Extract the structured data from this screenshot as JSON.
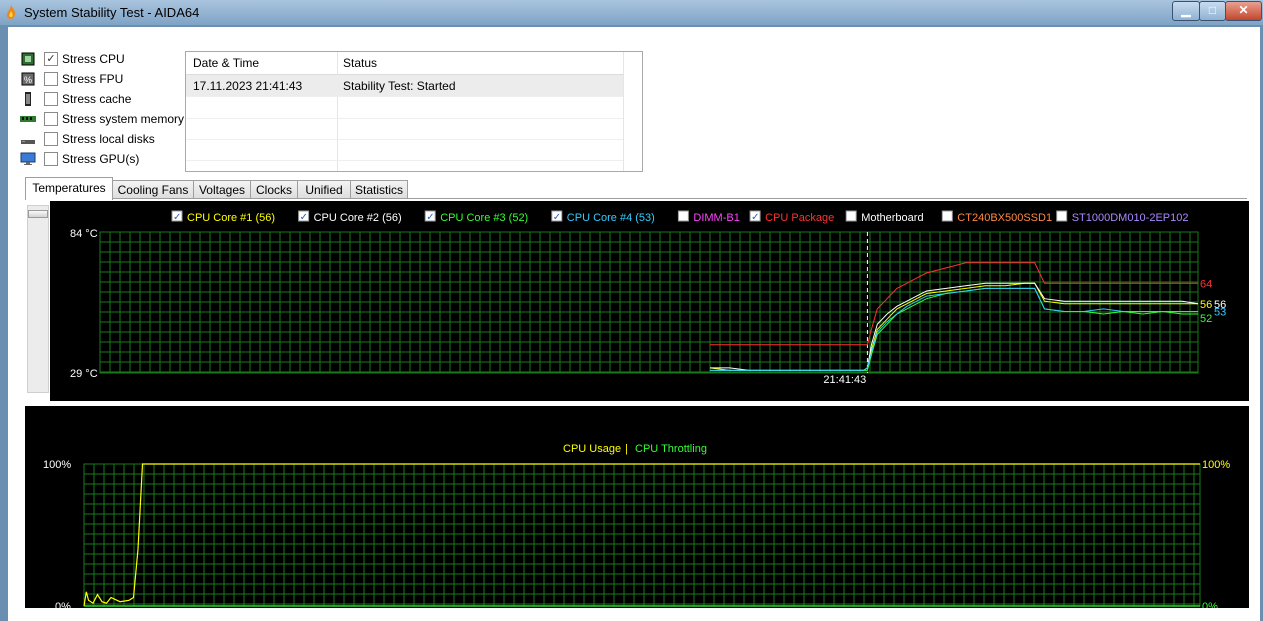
{
  "window": {
    "title": "System Stability Test - AIDA64",
    "min_label": "▁",
    "max_label": "□",
    "close_label": "✕"
  },
  "stress": [
    {
      "label": "Stress CPU",
      "checked": true,
      "icon": "cpu-icon"
    },
    {
      "label": "Stress FPU",
      "checked": false,
      "icon": "fpu-icon"
    },
    {
      "label": "Stress cache",
      "checked": false,
      "icon": "cache-icon"
    },
    {
      "label": "Stress system memory",
      "checked": false,
      "icon": "memory-icon"
    },
    {
      "label": "Stress local disks",
      "checked": false,
      "icon": "disk-icon"
    },
    {
      "label": "Stress GPU(s)",
      "checked": false,
      "icon": "gpu-icon"
    }
  ],
  "log": {
    "headers": [
      "Date & Time",
      "Status"
    ],
    "rows": [
      {
        "time": "17.11.2023 21:41:43",
        "status": "Stability Test: Started"
      }
    ]
  },
  "tabs": [
    "Temperatures",
    "Cooling Fans",
    "Voltages",
    "Clocks",
    "Unified",
    "Statistics"
  ],
  "chart_data": [
    {
      "type": "line",
      "ylim": [
        29,
        84
      ],
      "y_top_label": "84 °C",
      "y_bottom_label": "29 °C",
      "marker_time": "21:41:43",
      "legend": [
        {
          "label": "CPU Core #1 (56)",
          "checked": true,
          "color": "#ffff00"
        },
        {
          "label": "CPU Core #2 (56)",
          "checked": true,
          "color": "#ffffff"
        },
        {
          "label": "CPU Core #3 (52)",
          "checked": true,
          "color": "#33ff33"
        },
        {
          "label": "CPU Core #4 (53)",
          "checked": true,
          "color": "#33ccff"
        },
        {
          "label": "DIMM-B1",
          "checked": false,
          "color": "#ff44ff"
        },
        {
          "label": "CPU Package",
          "checked": true,
          "color": "#ff3333"
        },
        {
          "label": "Motherboard",
          "checked": false,
          "color": "#ffffff"
        },
        {
          "label": "CT240BX500SSD1",
          "checked": false,
          "color": "#ff8844"
        },
        {
          "label": "ST1000DM010-2EP102",
          "checked": false,
          "color": "#aa88ff"
        }
      ],
      "series": [
        {
          "name": "CPU Package",
          "color": "#ff3333",
          "end_label": "64",
          "x": [
            0,
            10,
            20,
            30,
            40,
            50,
            60,
            70,
            78,
            80,
            82,
            85,
            90,
            95,
            100,
            105,
            110,
            120,
            130,
            140,
            150,
            160,
            165,
            170,
            180,
            190,
            200,
            210,
            220,
            230,
            240,
            248
          ],
          "values": [
            40,
            40,
            40,
            40,
            40,
            40,
            40,
            40,
            40,
            40,
            46,
            54,
            58,
            62,
            64,
            66,
            68,
            70,
            72,
            72,
            72,
            72,
            72,
            64,
            64,
            64,
            64,
            64,
            64,
            64,
            64,
            64
          ]
        },
        {
          "name": "CPU Core #1",
          "color": "#ffff00",
          "end_label": "56",
          "x": [
            0,
            10,
            20,
            30,
            40,
            50,
            60,
            70,
            78,
            80,
            82,
            85,
            90,
            95,
            100,
            105,
            110,
            120,
            130,
            140,
            150,
            160,
            165,
            170,
            180,
            190,
            200,
            210,
            220,
            230,
            240,
            248
          ],
          "values": [
            31,
            30,
            30,
            30,
            30,
            30,
            30,
            30,
            30,
            31,
            38,
            46,
            50,
            54,
            56,
            58,
            60,
            61,
            62,
            63,
            63,
            64,
            64,
            57,
            56,
            56,
            56,
            56,
            56,
            56,
            56,
            56
          ]
        },
        {
          "name": "CPU Core #2",
          "color": "#ffffff",
          "end_label": "56",
          "x": [
            0,
            10,
            20,
            30,
            40,
            50,
            60,
            70,
            78,
            80,
            82,
            85,
            90,
            95,
            100,
            105,
            110,
            120,
            130,
            140,
            150,
            160,
            165,
            170,
            180,
            190,
            200,
            210,
            220,
            230,
            240,
            248
          ],
          "values": [
            31,
            31,
            30,
            30,
            30,
            30,
            30,
            30,
            30,
            31,
            40,
            48,
            52,
            55,
            57,
            59,
            61,
            62,
            63,
            64,
            64,
            64,
            64,
            58,
            57,
            57,
            57,
            57,
            57,
            57,
            57,
            56
          ]
        },
        {
          "name": "CPU Core #3",
          "color": "#33ff33",
          "end_label": "52",
          "x": [
            0,
            10,
            20,
            30,
            40,
            50,
            60,
            70,
            78,
            80,
            82,
            85,
            90,
            95,
            100,
            105,
            110,
            120,
            130,
            140,
            150,
            160,
            165,
            170,
            180,
            190,
            200,
            210,
            220,
            230,
            240,
            248
          ],
          "values": [
            30,
            30,
            30,
            30,
            30,
            30,
            30,
            30,
            30,
            30,
            36,
            44,
            48,
            52,
            54,
            56,
            58,
            60,
            61,
            62,
            62,
            62,
            62,
            54,
            53,
            53,
            52,
            53,
            52,
            53,
            52,
            52
          ]
        },
        {
          "name": "CPU Core #4",
          "color": "#33ccff",
          "end_label": "53",
          "x": [
            0,
            10,
            20,
            30,
            40,
            50,
            60,
            70,
            78,
            80,
            82,
            85,
            90,
            95,
            100,
            105,
            110,
            120,
            130,
            140,
            150,
            160,
            165,
            170,
            180,
            190,
            200,
            210,
            220,
            230,
            240,
            248
          ],
          "values": [
            30,
            30,
            30,
            30,
            30,
            30,
            30,
            30,
            30,
            31,
            37,
            45,
            49,
            52,
            55,
            57,
            59,
            60,
            61,
            62,
            62,
            62,
            62,
            54,
            53,
            53,
            54,
            53,
            53,
            53,
            53,
            53
          ]
        }
      ]
    },
    {
      "type": "line",
      "ylim": [
        0,
        100
      ],
      "legend": [
        {
          "label": "CPU Usage",
          "color": "#ffff00"
        },
        {
          "label": "CPU Throttling",
          "color": "#33ff33"
        }
      ],
      "separator": "|",
      "y_top_label": "100%",
      "y_bottom_label": "0%",
      "series": [
        {
          "name": "CPU Usage",
          "color": "#ffff00",
          "x": [
            0,
            0.5,
            1,
            2,
            3,
            4,
            5,
            6,
            8,
            10,
            11,
            12,
            13,
            14,
            20,
            40,
            60,
            80,
            100,
            120,
            140,
            160,
            180,
            200,
            220,
            240,
            248
          ],
          "values": [
            0,
            10,
            4,
            2,
            8,
            3,
            2,
            6,
            3,
            4,
            6,
            40,
            100,
            100,
            100,
            100,
            100,
            100,
            100,
            100,
            100,
            100,
            100,
            100,
            100,
            100,
            100
          ]
        },
        {
          "name": "CPU Throttling",
          "color": "#33ff33",
          "x": [
            0,
            248
          ],
          "values": [
            0,
            0
          ]
        }
      ]
    }
  ]
}
